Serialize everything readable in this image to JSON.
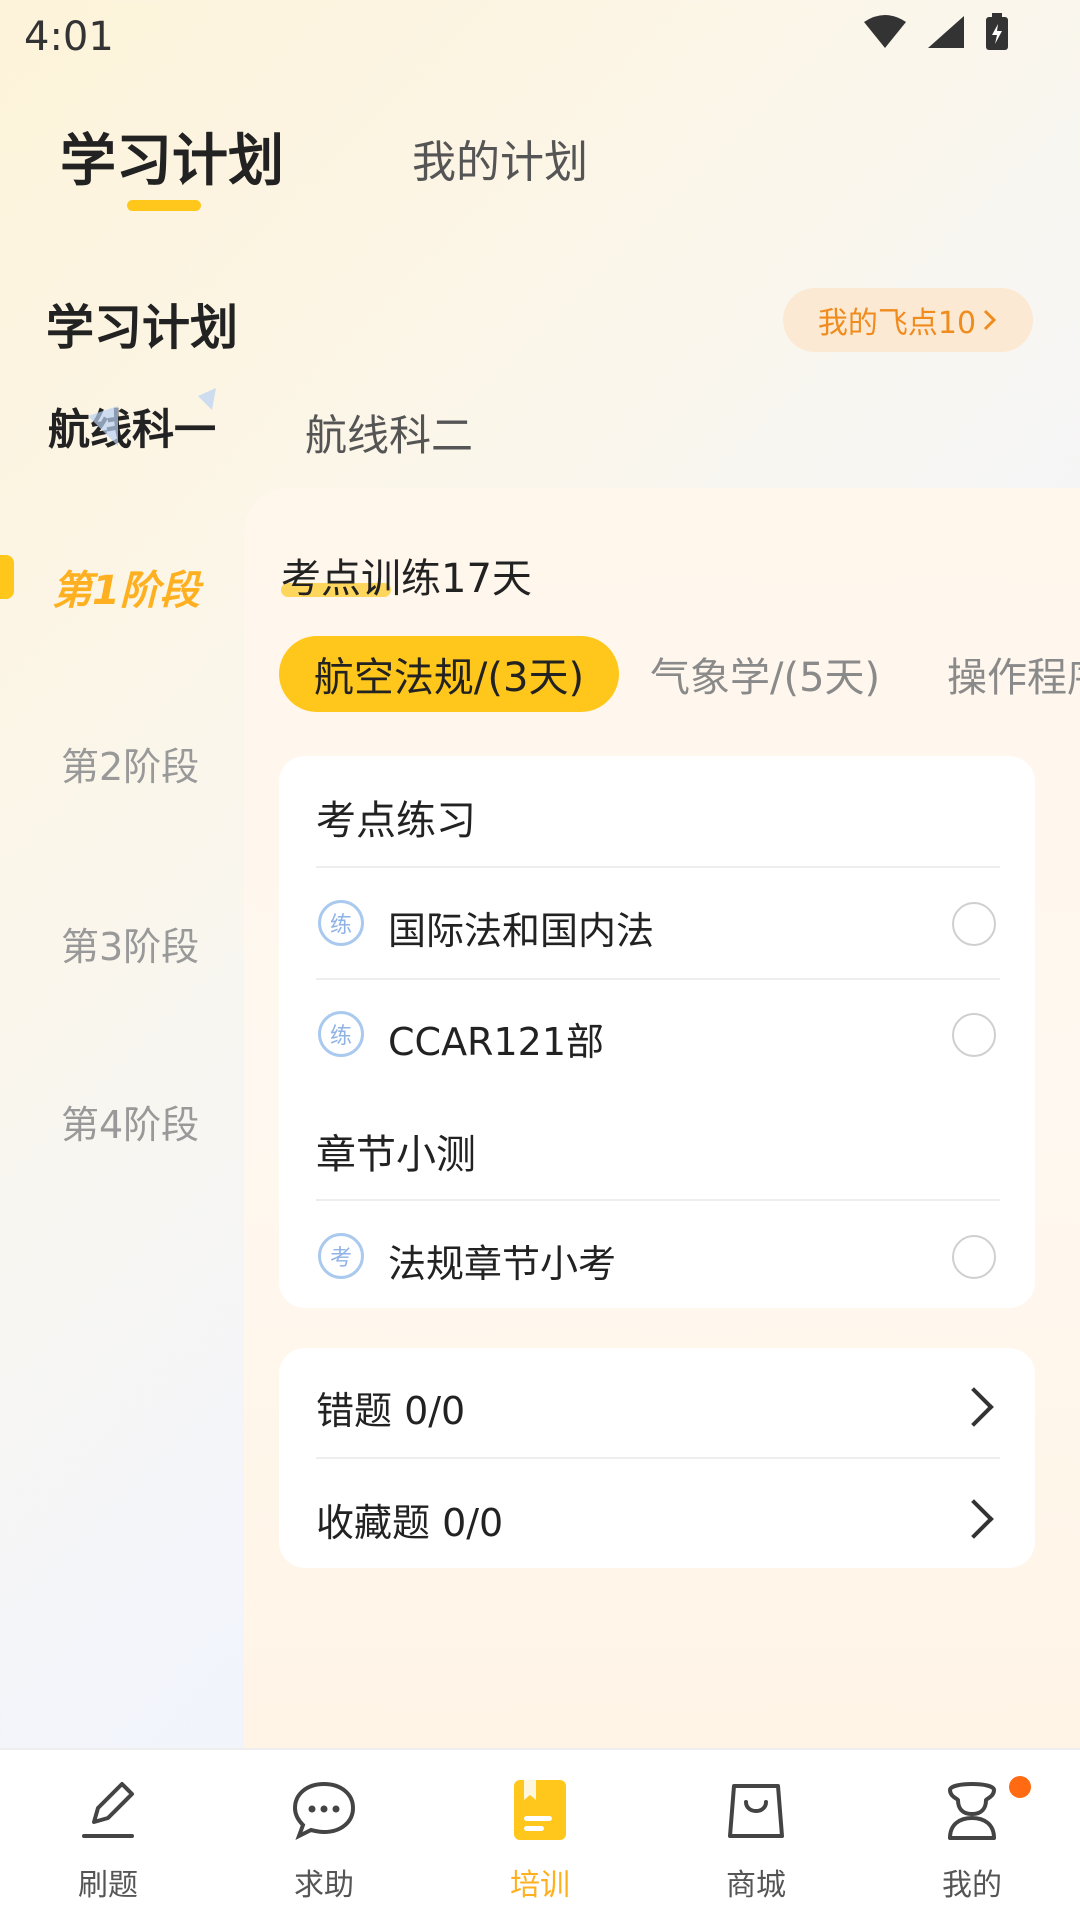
{
  "status": {
    "time": "4:01"
  },
  "tabs": {
    "active": "学习计划",
    "inactive": "我的计划"
  },
  "section": {
    "title": "学习计划",
    "points_label": "我的飞点10"
  },
  "courses": [
    "航线科一",
    "航线科二"
  ],
  "stages": [
    "第1阶段",
    "第2阶段",
    "第3阶段",
    "第4阶段"
  ],
  "panel": {
    "title": "考点训练17天",
    "chips": [
      "航空法规/(3天)",
      "气象学/(5天)",
      "操作程序"
    ],
    "practice": {
      "header": "考点练习",
      "items": [
        {
          "icon_text": "练",
          "label": "国际法和国内法"
        },
        {
          "icon_text": "练",
          "label": "CCAR121部"
        }
      ]
    },
    "quiz": {
      "header": "章节小测",
      "items": [
        {
          "icon_text": "考",
          "label": "法规章节小考"
        }
      ]
    },
    "links": [
      {
        "label": "错题 0/0"
      },
      {
        "label": "收藏题 0/0"
      }
    ]
  },
  "nav": [
    "刷题",
    "求助",
    "培训",
    "商城",
    "我的"
  ],
  "colors": {
    "accent": "#ffc71b",
    "accent_text": "#ffb020",
    "points_text": "#f08c1e",
    "badge": "#ff6a13"
  }
}
